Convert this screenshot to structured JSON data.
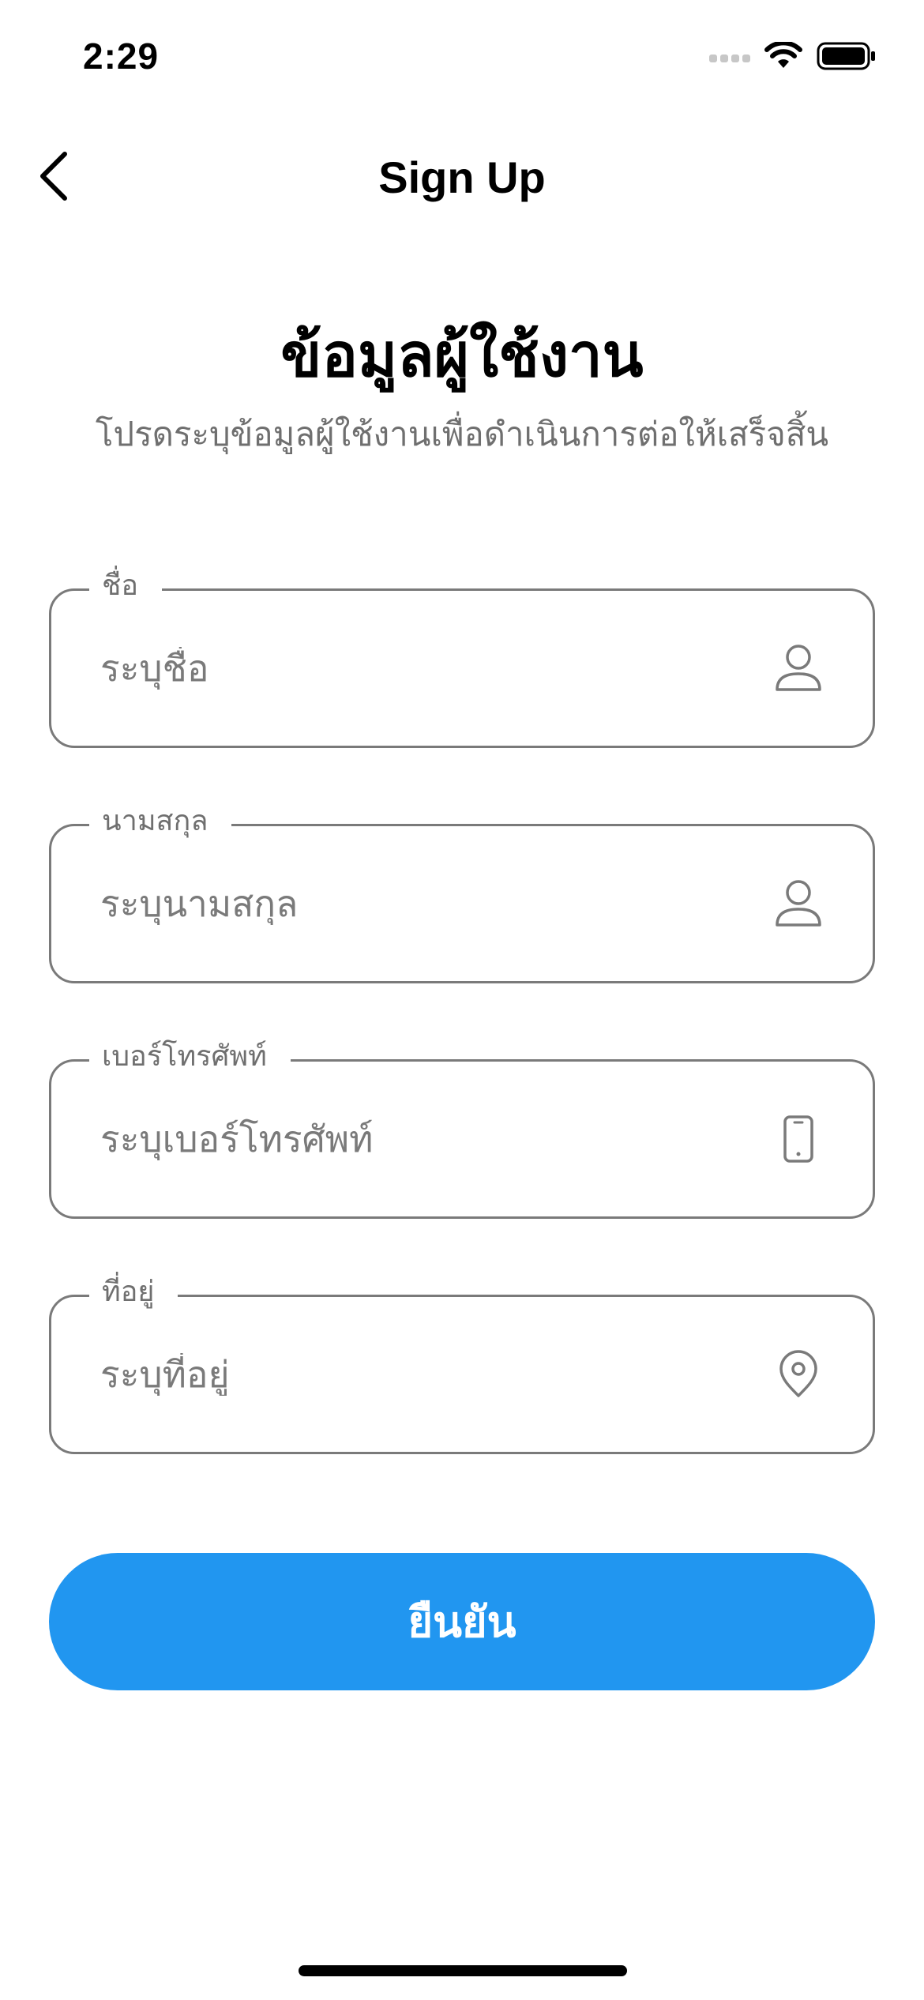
{
  "status_bar": {
    "time": "2:29",
    "icons": [
      "cellular-signal-icon",
      "wifi-icon",
      "battery-icon"
    ]
  },
  "nav": {
    "back_icon": "chevron-left-icon",
    "title": "Sign Up"
  },
  "header": {
    "title": "ข้อมูลผู้ใช้งาน",
    "subtitle": "โปรดระบุข้อมูลผู้ใช้งานเพื่อดำเนินการต่อให้เสร็จสิ้น"
  },
  "form": {
    "first_name": {
      "label": "ชื่อ",
      "placeholder": "ระบุชื่อ",
      "value": "",
      "icon": "person-icon"
    },
    "last_name": {
      "label": "นามสกุล",
      "placeholder": "ระบุนามสกุล",
      "value": "",
      "icon": "person-icon"
    },
    "phone": {
      "label": "เบอร์โทรศัพท์",
      "placeholder": "ระบุเบอร์โทรศัพท์",
      "value": "",
      "icon": "smartphone-icon"
    },
    "address": {
      "label": "ที่อยู่",
      "placeholder": "ระบุที่อยู่",
      "value": "",
      "icon": "map-pin-icon"
    },
    "confirm_label": "ยืนยัน"
  },
  "colors": {
    "accent": "#2196F0",
    "field_border": "#7A7A7A",
    "muted_text": "#6F6F6F",
    "text": "#000000",
    "background": "#FFFFFF"
  }
}
